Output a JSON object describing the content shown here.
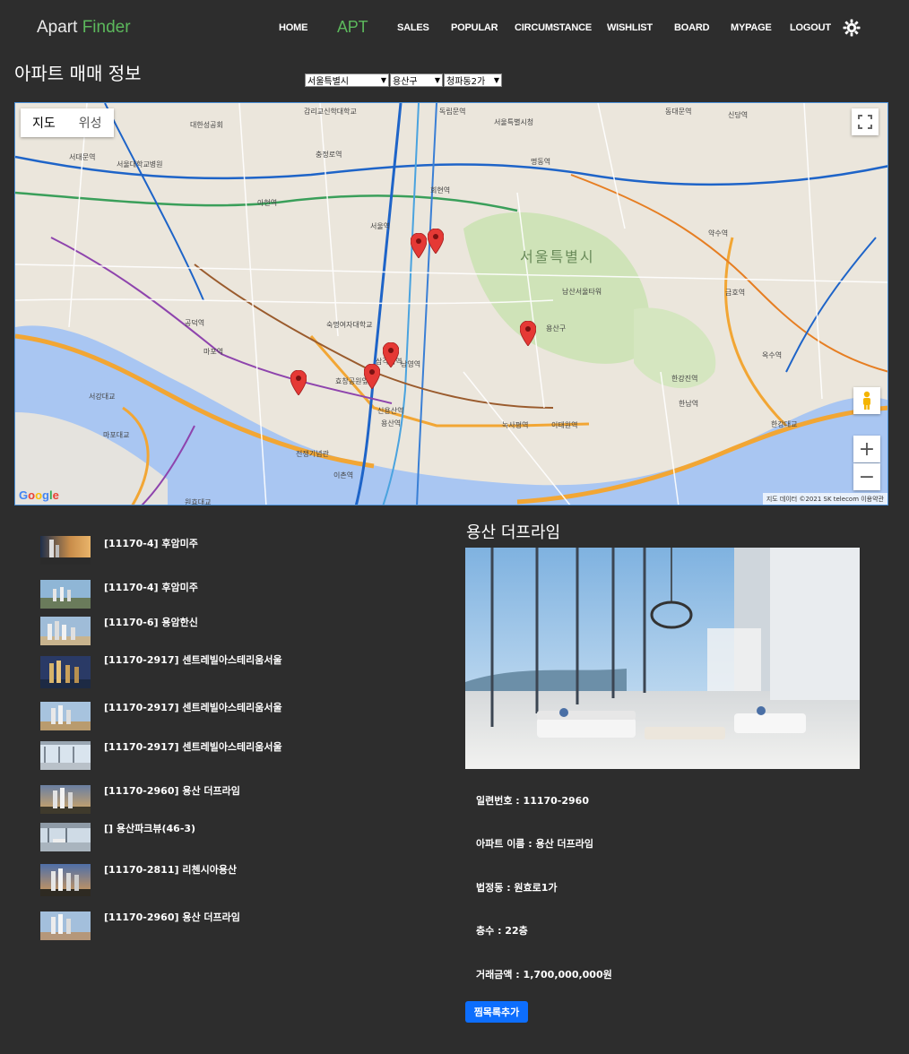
{
  "nav": {
    "brand_main": "Apart",
    "brand_accent": "Finder",
    "items": [
      {
        "label": "HOME",
        "active": false
      },
      {
        "label": "APT",
        "active": true
      },
      {
        "label": "SALES",
        "active": false
      },
      {
        "label": "POPULAR",
        "active": false
      },
      {
        "label": "CIRCUMSTANCE",
        "active": false
      },
      {
        "label": "WISHLIST",
        "active": false
      },
      {
        "label": "BOARD",
        "active": false
      },
      {
        "label": "MYPAGE",
        "active": false
      },
      {
        "label": "LOGOUT",
        "active": false
      }
    ],
    "theme_icon": "gear-icon"
  },
  "page": {
    "title": "아파트 매매 정보"
  },
  "filters": {
    "city": "서울특별시",
    "district": "용산구",
    "dong": "청파동2가"
  },
  "map": {
    "type_buttons": [
      "지도",
      "위성"
    ],
    "active_type": "지도",
    "region_label": "서울특별시",
    "attribution": "지도 데이터 ©2021 SK telecom  이용약관",
    "logo": "Google",
    "zoom_in": "+",
    "zoom_out": "−",
    "labels": [
      "감리교신학대학교",
      "독립문역",
      "서대문역",
      "충정로역",
      "아현역",
      "공덕역",
      "마포역",
      "서울역",
      "회현역",
      "명동역",
      "남산서울타워",
      "용산구",
      "삼각지역",
      "숙명여자대학교",
      "효창공원앞역",
      "남영역",
      "용산역",
      "신용산역",
      "이촌역",
      "한강진역",
      "이태원역",
      "녹사평역",
      "한남역",
      "옥수역",
      "약수역",
      "금호역",
      "신당역",
      "동대문역",
      "한강대교",
      "마포대교",
      "원효대교",
      "서강대교",
      "전쟁기념관",
      "서울특별시청",
      "서울대학교병원",
      "대한성공회"
    ]
  },
  "list": [
    {
      "text": "[11170-4] 후암미주"
    },
    {
      "text": "[11170-4] 후암미주"
    },
    {
      "text": "[11170-6] 용암한신"
    },
    {
      "text": "[11170-2917] 센트레빌아스테리움서울"
    },
    {
      "text": "[11170-2917] 센트레빌아스테리움서울"
    },
    {
      "text": "[11170-2917] 센트레빌아스테리움서울"
    },
    {
      "text": "[11170-2960] 용산 더프라임"
    },
    {
      "text": "[] 용산파크뷰(46-3)"
    },
    {
      "text": "[11170-2811] 리첸시아용산"
    },
    {
      "text": "[11170-2960] 용산 더프라임"
    }
  ],
  "detail": {
    "title": "용산 더프라임",
    "serial": "일련번호 : 11170-2960",
    "name": "아파트 이름 : 용산 더프라임",
    "dong": "법정동 : 원효로1가",
    "floor": "층수 : 22층",
    "price": "거래금액 : 1,700,000,000원",
    "wish_button": "찜목록추가"
  },
  "colors": {
    "background": "#2d2d2d",
    "accent_green": "#5cb85c",
    "button_blue": "#0d6efd",
    "marker_red": "#e53935"
  }
}
